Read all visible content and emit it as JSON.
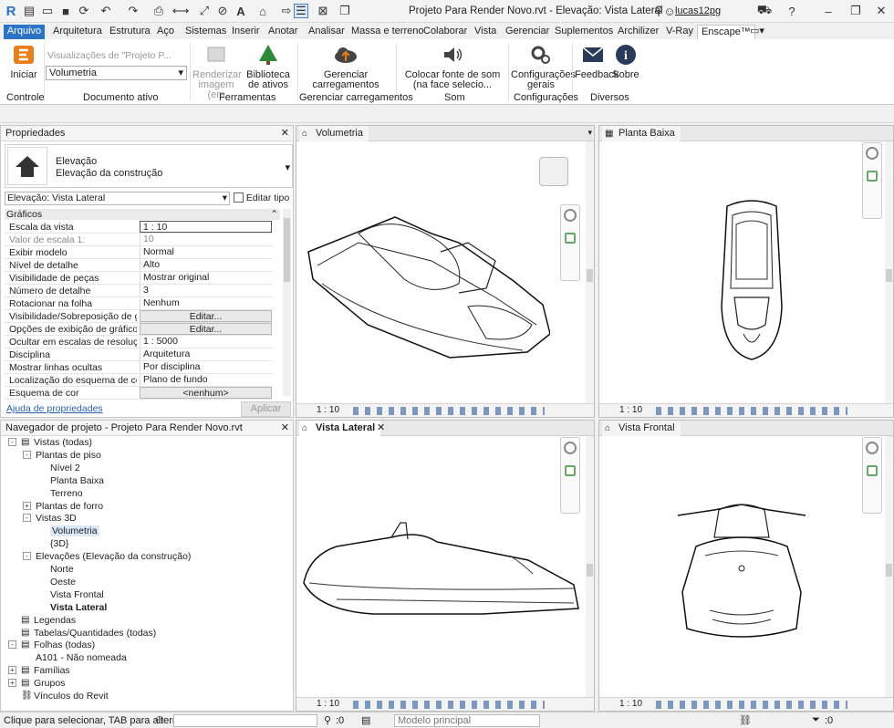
{
  "titlebar": {
    "title": "Projeto Para Render Novo.rvt - Elevação: Vista Lateral",
    "user": "lucas12pg",
    "help": "?"
  },
  "menu": {
    "file": "Arquivo",
    "tabs": [
      "Arquitetura",
      "Estrutura",
      "Aço",
      "Sistemas",
      "Inserir",
      "Anotar",
      "Analisar",
      "Massa e terreno",
      "Colaborar",
      "Vista",
      "Gerenciar",
      "Suplementos",
      "Archilizer",
      "V-Ray",
      "Enscape™"
    ],
    "active_tab": "Enscape™"
  },
  "ribbon": {
    "start_label": "Iniciar",
    "views_placeholder": "Visualizações de \"Projeto P...",
    "view_select": "Volumetria",
    "render_label": "Renderizar imagem (em",
    "asset_label": "Biblioteca de ativos",
    "uploads_label": "Gerenciar carregamentos",
    "sound_label": "Colocar fonte de som (na face selecio...",
    "settings_label": "Configurações gerais",
    "feedback_label": "Feedback",
    "about_label": "Sobre",
    "groups": [
      "Controle",
      "Documento ativo",
      "Ferramentas",
      "Gerenciar carregamentos",
      "Som",
      "Configurações",
      "Diversos"
    ]
  },
  "properties": {
    "title": "Propriedades",
    "type_name": "Elevação",
    "type_sub": "Elevação da construção",
    "instance": "Elevação: Vista Lateral",
    "edit_type": "Editar tipo",
    "section": "Gráficos",
    "rows": [
      {
        "k": "Escala da vista",
        "v": "1 : 10"
      },
      {
        "k": "Valor de escala    1:",
        "v": "10"
      },
      {
        "k": "Exibir modelo",
        "v": "Normal"
      },
      {
        "k": "Nível de detalhe",
        "v": "Alto"
      },
      {
        "k": "Visibilidade de peças",
        "v": "Mostrar original"
      },
      {
        "k": "Número de detalhe",
        "v": "3"
      },
      {
        "k": "Rotacionar na folha",
        "v": "Nenhum"
      },
      {
        "k": "Visibilidade/Sobreposição de grá...",
        "v": "Editar..."
      },
      {
        "k": "Opções de exibição de gráficos",
        "v": "Editar..."
      },
      {
        "k": "Ocultar em escalas de resolução ...",
        "v": "1 : 5000"
      },
      {
        "k": "Disciplina",
        "v": "Arquitetura"
      },
      {
        "k": "Mostrar linhas ocultas",
        "v": "Por disciplina"
      },
      {
        "k": "Localização do esquema de cor",
        "v": "Plano de fundo"
      },
      {
        "k": "Esquema de cor",
        "v": "<nenhum>"
      }
    ],
    "help_link": "Ajuda de propriedades",
    "apply": "Aplicar"
  },
  "browser": {
    "title": "Navegador de projeto - Projeto Para Render Novo.rvt",
    "items": [
      "Vistas (todas)",
      "Plantas de piso",
      "Nível 2",
      "Planta Baixa",
      "Terreno",
      "Plantas de forro",
      "Vistas 3D",
      "Volumetria",
      "{3D}",
      "Elevações (Elevação da construção)",
      "Norte",
      "Oeste",
      "Vista Frontal",
      "Vista Lateral",
      "Legendas",
      "Tabelas/Quantidades (todas)",
      "Folhas (todas)",
      "A101 - Não nomeada",
      "Famílias",
      "Grupos",
      "Vínculos do Revit"
    ]
  },
  "viewports": [
    {
      "name": "Volumetria",
      "scale": "1 : 10"
    },
    {
      "name": "Planta Baixa",
      "scale": "1 : 10"
    },
    {
      "name": "Vista Lateral",
      "scale": "1 : 10"
    },
    {
      "name": "Vista Frontal",
      "scale": "1 : 10"
    }
  ],
  "status": {
    "hint": "Clique para selecionar, TAB para alternat",
    "count": ":0",
    "model": "Modelo principal",
    "filter": ":0"
  },
  "colors": {
    "file_tab": "#2a73c7",
    "selection": "#dbe8f7"
  }
}
